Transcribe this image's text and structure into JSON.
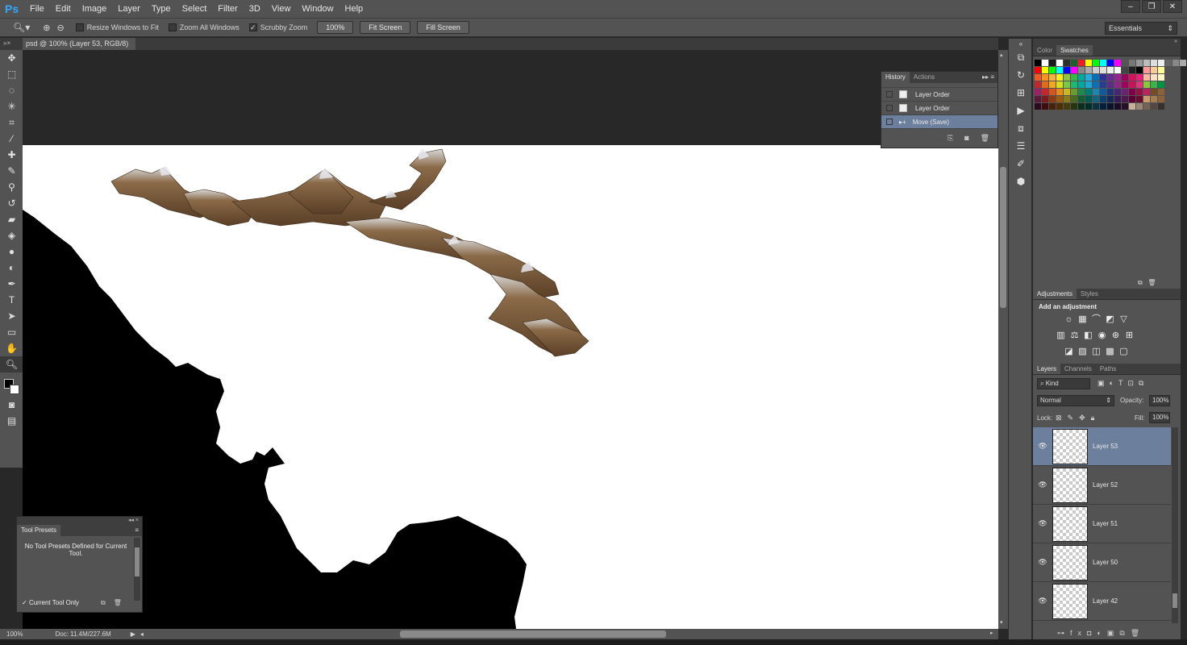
{
  "app": {
    "logo": "Ps"
  },
  "menu": [
    "File",
    "Edit",
    "Image",
    "Layer",
    "Type",
    "Select",
    "Filter",
    "3D",
    "View",
    "Window",
    "Help"
  ],
  "window_buttons": [
    "–",
    "❐",
    "✕"
  ],
  "options": {
    "resize_windows": "Resize Windows to Fit",
    "zoom_all": "Zoom All Windows",
    "scrubby": "Scrubby Zoom",
    "zoom_value": "100%",
    "fit_screen": "Fit Screen",
    "fill_screen": "Fill Screen",
    "workspace": "Essentials"
  },
  "doc_tab": {
    "title": "psd @ 100% (Layer 53, RGB/8)",
    "close": "×"
  },
  "history": {
    "tabs": [
      "History",
      "Actions"
    ],
    "items": [
      {
        "label": "Layer Order"
      },
      {
        "label": "Layer Order"
      },
      {
        "label": "Move (Save)"
      }
    ]
  },
  "color_panel": {
    "tabs": [
      "Color",
      "Swatches"
    ]
  },
  "adjustments": {
    "tabs": [
      "Adjustments",
      "Styles"
    ],
    "heading": "Add an adjustment"
  },
  "layers_panel": {
    "tabs": [
      "Layers",
      "Channels",
      "Paths"
    ],
    "kind": "Kind",
    "blend_mode": "Normal",
    "opacity_label": "Opacity:",
    "opacity": "100%",
    "lock_label": "Lock:",
    "fill_label": "Fill:",
    "fill": "100%",
    "layers": [
      "Layer 53",
      "Layer 52",
      "Layer 51",
      "Layer 50",
      "Layer 42"
    ],
    "selected": "Layer 53"
  },
  "tool_presets": {
    "title": "Tool Presets",
    "message": "No Tool Presets Defined for Current Tool.",
    "current_only": "Current Tool Only"
  },
  "status": {
    "zoom": "100%",
    "doc": "Doc: 11.4M/227.6M"
  },
  "swatch_colors": [
    "#000000",
    "#ffffff",
    "#1a1a1a",
    "#ffffff",
    "#2e2e2e",
    "#1f5c2e",
    "#ed1c24",
    "#ffff00",
    "#00ff00",
    "#00ffff",
    "#0000ff",
    "#ff00ff"
  ]
}
